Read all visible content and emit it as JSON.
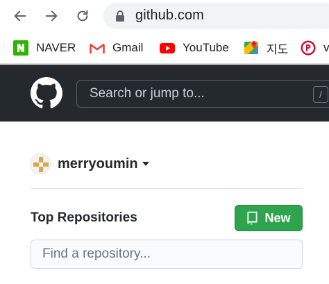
{
  "browser": {
    "url": "github.com",
    "back_icon": "arrow-left-icon",
    "forward_icon": "arrow-right-icon",
    "reload_icon": "reload-icon"
  },
  "bookmarks": [
    {
      "label": "NAVER",
      "icon": "naver-icon",
      "color": "#2db400"
    },
    {
      "label": "Gmail",
      "icon": "gmail-icon",
      "color": "#ea4335"
    },
    {
      "label": "YouTube",
      "icon": "youtube-icon",
      "color": "#ff0000"
    },
    {
      "label": "지도",
      "icon": "google-maps-icon",
      "color": "#34a853"
    },
    {
      "label": "v",
      "icon": "p-icon",
      "color": "#c8102e"
    }
  ],
  "github": {
    "search_placeholder": "Search or jump to...",
    "search_shortcut": "/",
    "header_bg": "#24292e"
  },
  "dashboard": {
    "username": "merryoumin",
    "top_repositories_title": "Top Repositories",
    "new_button_label": "New",
    "find_repo_placeholder": "Find a repository...",
    "accent_green": "#2ea44f"
  }
}
